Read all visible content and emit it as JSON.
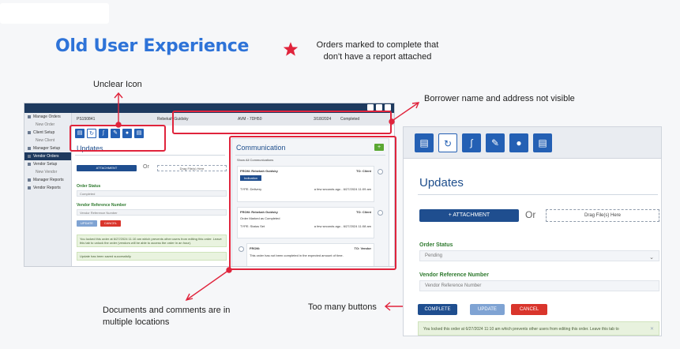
{
  "headline": "Old User Experience",
  "annotations": {
    "star_note": "Orders marked to complete that don't have a report attached",
    "unclear_icon": "Unclear Icon",
    "borrower": "Borrower name and address not visible",
    "documents": "Documents and comments are in multiple locations",
    "too_many_buttons": "Too many buttons"
  },
  "colors": {
    "accent": "#2e73d8",
    "highlight": "#e0243c",
    "nav": "#1e3a5f",
    "primary_button": "#1f4e8f",
    "cancel_button": "#d9352c"
  },
  "left_screenshot": {
    "sidebar": [
      {
        "label": "Manage Orders",
        "sub": false,
        "active": false
      },
      {
        "label": "New Order",
        "sub": true,
        "active": false
      },
      {
        "label": "Client Setup",
        "sub": false,
        "active": false
      },
      {
        "label": "New Client",
        "sub": true,
        "active": false
      },
      {
        "label": "Manager Setup",
        "sub": false,
        "active": false
      },
      {
        "label": "Vendor Orders",
        "sub": false,
        "active": true
      },
      {
        "label": "Vendor Setup",
        "sub": false,
        "active": false
      },
      {
        "label": "New Vendor",
        "sub": true,
        "active": false
      },
      {
        "label": "Manager Reports",
        "sub": false,
        "active": false
      },
      {
        "label": "Vendor Reports",
        "sub": false,
        "active": false
      }
    ],
    "info": {
      "order_no": "PS150841",
      "name": "Rebekah Guidsky",
      "code": "AVM - 7DH50",
      "date": "3/18/2024",
      "status": "Completed"
    },
    "updates_title": "Updates",
    "attachment_label": "ATTACHMENT",
    "or_label": "Or",
    "drag_label": "Drag File(s) Here",
    "order_status_label": "Order Status",
    "order_status_value": "Completed",
    "vendor_ref_label": "Vendor Reference Number",
    "vendor_ref_placeholder": "Vendor Reference Number",
    "update_label": "UPDATE",
    "cancel_label": "CANCEL",
    "lock_note": "You locked this order at 6/27/2024 11:10 am which prevents other users from editing this order. Leave this tab to unlock the order (vendors will be able to access the order in an hour).",
    "update_note": "Update has been saved successfully",
    "communication": {
      "title": "Communication",
      "show_all": "Show All Communications",
      "cards": [
        {
          "from": "FROM: Rebekah Guidsky",
          "to": "TO: Client",
          "type": "TYPE: Delivery",
          "time": "a few seconds ago - 6/27/2024 11:09 am",
          "button": "Indication"
        },
        {
          "from": "FROM: Rebekah Guidsky",
          "to": "TO: Client",
          "body": "Order Marked as Completed",
          "type": "TYPE: Status Set",
          "time": "a few seconds ago - 6/27/2024 11:08 am"
        },
        {
          "from": "FROM:",
          "to": "TO: Vendor",
          "body": "This order has not been completed in the expected amount of time."
        }
      ]
    }
  },
  "right_screenshot": {
    "updates_title": "Updates",
    "attachment_label": "+ ATTACHMENT",
    "or_label": "Or",
    "drag_label": "Drag File(s) Here",
    "order_status_label": "Order Status",
    "order_status_value": "Pending",
    "vendor_ref_label": "Vendor Reference Number",
    "vendor_ref_placeholder": "Vendor Reference Number",
    "complete_label": "COMPLETE",
    "update_label": "UPDATE",
    "cancel_label": "CANCEL",
    "lock_note": "You locked this order at 6/27/2024 11:10 am which prevents other users from editing this order. Leave this tab to"
  }
}
